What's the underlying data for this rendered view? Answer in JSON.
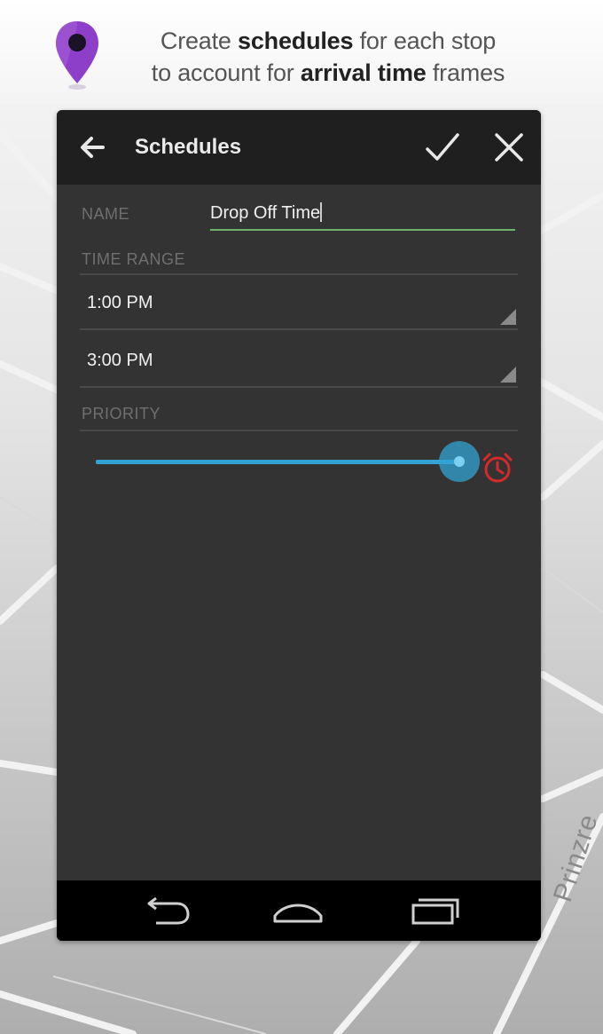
{
  "headline": {
    "line1_pre": "Create ",
    "line1_bold": "schedules",
    "line1_post": " for each stop",
    "line2_pre": "to account for ",
    "line2_bold": "arrival time",
    "line2_post": " frames"
  },
  "map": {
    "street_label": "Prinzre"
  },
  "colors": {
    "pin": "#8e3fc9",
    "accent": "#33a3d3",
    "input_underline": "#6fb46a",
    "alarm": "#d42a2a"
  },
  "actionbar": {
    "title": "Schedules",
    "back_icon": "arrow-left",
    "ok_icon": "checkmark",
    "close_icon": "x"
  },
  "form": {
    "name_label": "NAME",
    "name_value": "Drop Off Time",
    "time_range_label": "TIME RANGE",
    "start_time": "1:00 PM",
    "end_time": "3:00 PM",
    "priority_label": "PRIORITY",
    "priority_level": 1.0
  },
  "navbar": {
    "back_icon": "nav-back",
    "home_icon": "nav-home",
    "recents_icon": "nav-recents"
  }
}
